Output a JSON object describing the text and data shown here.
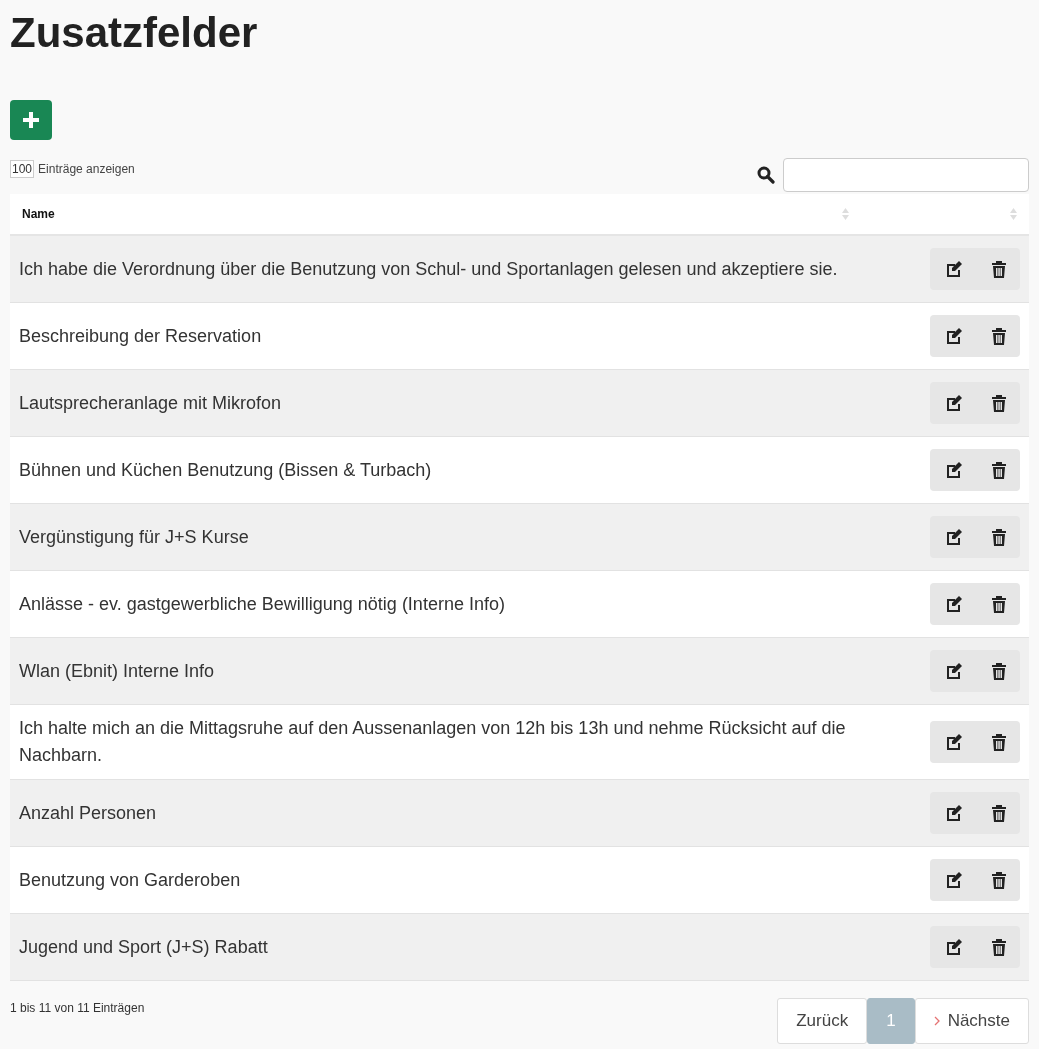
{
  "title": "Zusatzfelder",
  "length": {
    "value": "100",
    "label": "Einträge anzeigen"
  },
  "table": {
    "columns": [
      {
        "label": "Name",
        "sortable": true
      },
      {
        "sortable": true
      }
    ],
    "rows": [
      {
        "name": "Ich habe die Verordnung über die Benutzung von Schul- und Sportanlagen gelesen und akzeptiere sie."
      },
      {
        "name": "Beschreibung der Reservation"
      },
      {
        "name": "Lautsprecheranlage mit Mikrofon"
      },
      {
        "name": "Bühnen und Küchen Benutzung (Bissen & Turbach)"
      },
      {
        "name": "Vergünstigung für J+S Kurse"
      },
      {
        "name": "Anlässe - ev. gastgewerbliche Bewilligung nötig (Interne Info)"
      },
      {
        "name": "Wlan (Ebnit) Interne Info"
      },
      {
        "name": "Ich halte mich an die Mittagsruhe auf den Aussenanlagen von 12h bis 13h und nehme Rücksicht auf die Nachbarn."
      },
      {
        "name": "Anzahl Personen"
      },
      {
        "name": "Benutzung von Garderoben"
      },
      {
        "name": "Jugend und Sport (J+S) Rabatt"
      }
    ]
  },
  "info": "1 bis 11 von 11 Einträgen",
  "pagination": {
    "previous": "Zurück",
    "pages": [
      {
        "label": "1",
        "selected": true
      }
    ],
    "next": "Nächste"
  }
}
